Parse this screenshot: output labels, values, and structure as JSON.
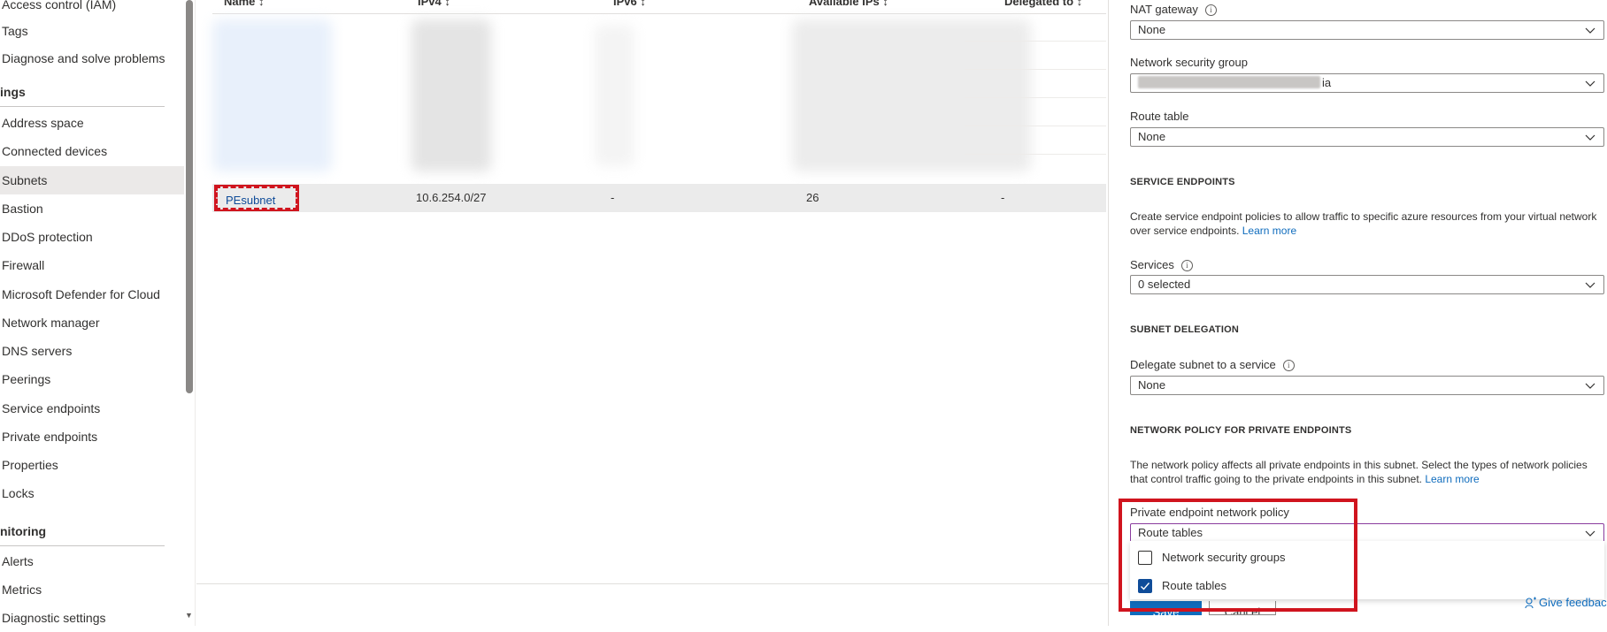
{
  "sidebar": {
    "items": [
      {
        "label": "Access control (IAM)"
      },
      {
        "label": "Tags"
      },
      {
        "label": "Diagnose and solve problems"
      }
    ],
    "settings_header": "ings",
    "settings_items": [
      {
        "label": "Address space"
      },
      {
        "label": "Connected devices"
      },
      {
        "label": "Subnets"
      },
      {
        "label": "Bastion"
      },
      {
        "label": "DDoS protection"
      },
      {
        "label": "Firewall"
      },
      {
        "label": "Microsoft Defender for Cloud"
      },
      {
        "label": "Network manager"
      },
      {
        "label": "DNS servers"
      },
      {
        "label": "Peerings"
      },
      {
        "label": "Service endpoints"
      },
      {
        "label": "Private endpoints"
      },
      {
        "label": "Properties"
      },
      {
        "label": "Locks"
      }
    ],
    "monitoring_header": "nitoring",
    "monitoring_items": [
      {
        "label": "Alerts"
      },
      {
        "label": "Metrics"
      },
      {
        "label": "Diagnostic settings"
      }
    ]
  },
  "grid": {
    "columns": [
      "Name",
      "IPv4",
      "IPv6",
      "Available IPs",
      "Delegated to"
    ],
    "row": {
      "name": "PEsubnet",
      "ipv4": "10.6.254.0/27",
      "ipv6": "-",
      "available_ips": "26",
      "delegated_to": "-"
    }
  },
  "panel": {
    "nat_gateway": {
      "label": "NAT gateway",
      "value": "None"
    },
    "nsg": {
      "label": "Network security group",
      "value_suffix": "ia"
    },
    "route_table": {
      "label": "Route table",
      "value": "None"
    },
    "service_endpoints": {
      "header": "SERVICE ENDPOINTS",
      "description": "Create service endpoint policies to allow traffic to specific azure resources from your virtual network over service endpoints.",
      "learn_more": "Learn more",
      "services_label": "Services",
      "services_value": "0 selected"
    },
    "delegation": {
      "header": "SUBNET DELEGATION",
      "label": "Delegate subnet to a service",
      "value": "None"
    },
    "network_policy": {
      "header": "NETWORK POLICY FOR PRIVATE ENDPOINTS",
      "description": "The network policy affects all private endpoints in this subnet. Select the types of network policies that control traffic going to the private endpoints in this subnet.",
      "learn_more": "Learn more",
      "label": "Private endpoint network policy",
      "value": "Route tables",
      "options": [
        {
          "label": "Network security groups",
          "checked": false
        },
        {
          "label": "Route tables",
          "checked": true
        }
      ]
    },
    "save_label": "Save",
    "cancel_label": "Cancel",
    "feedback_label": "Give feedback"
  },
  "colors": {
    "accent": "#0f6cbd",
    "highlight": "#d0141e",
    "selected_nav": "#ebe9e8"
  }
}
